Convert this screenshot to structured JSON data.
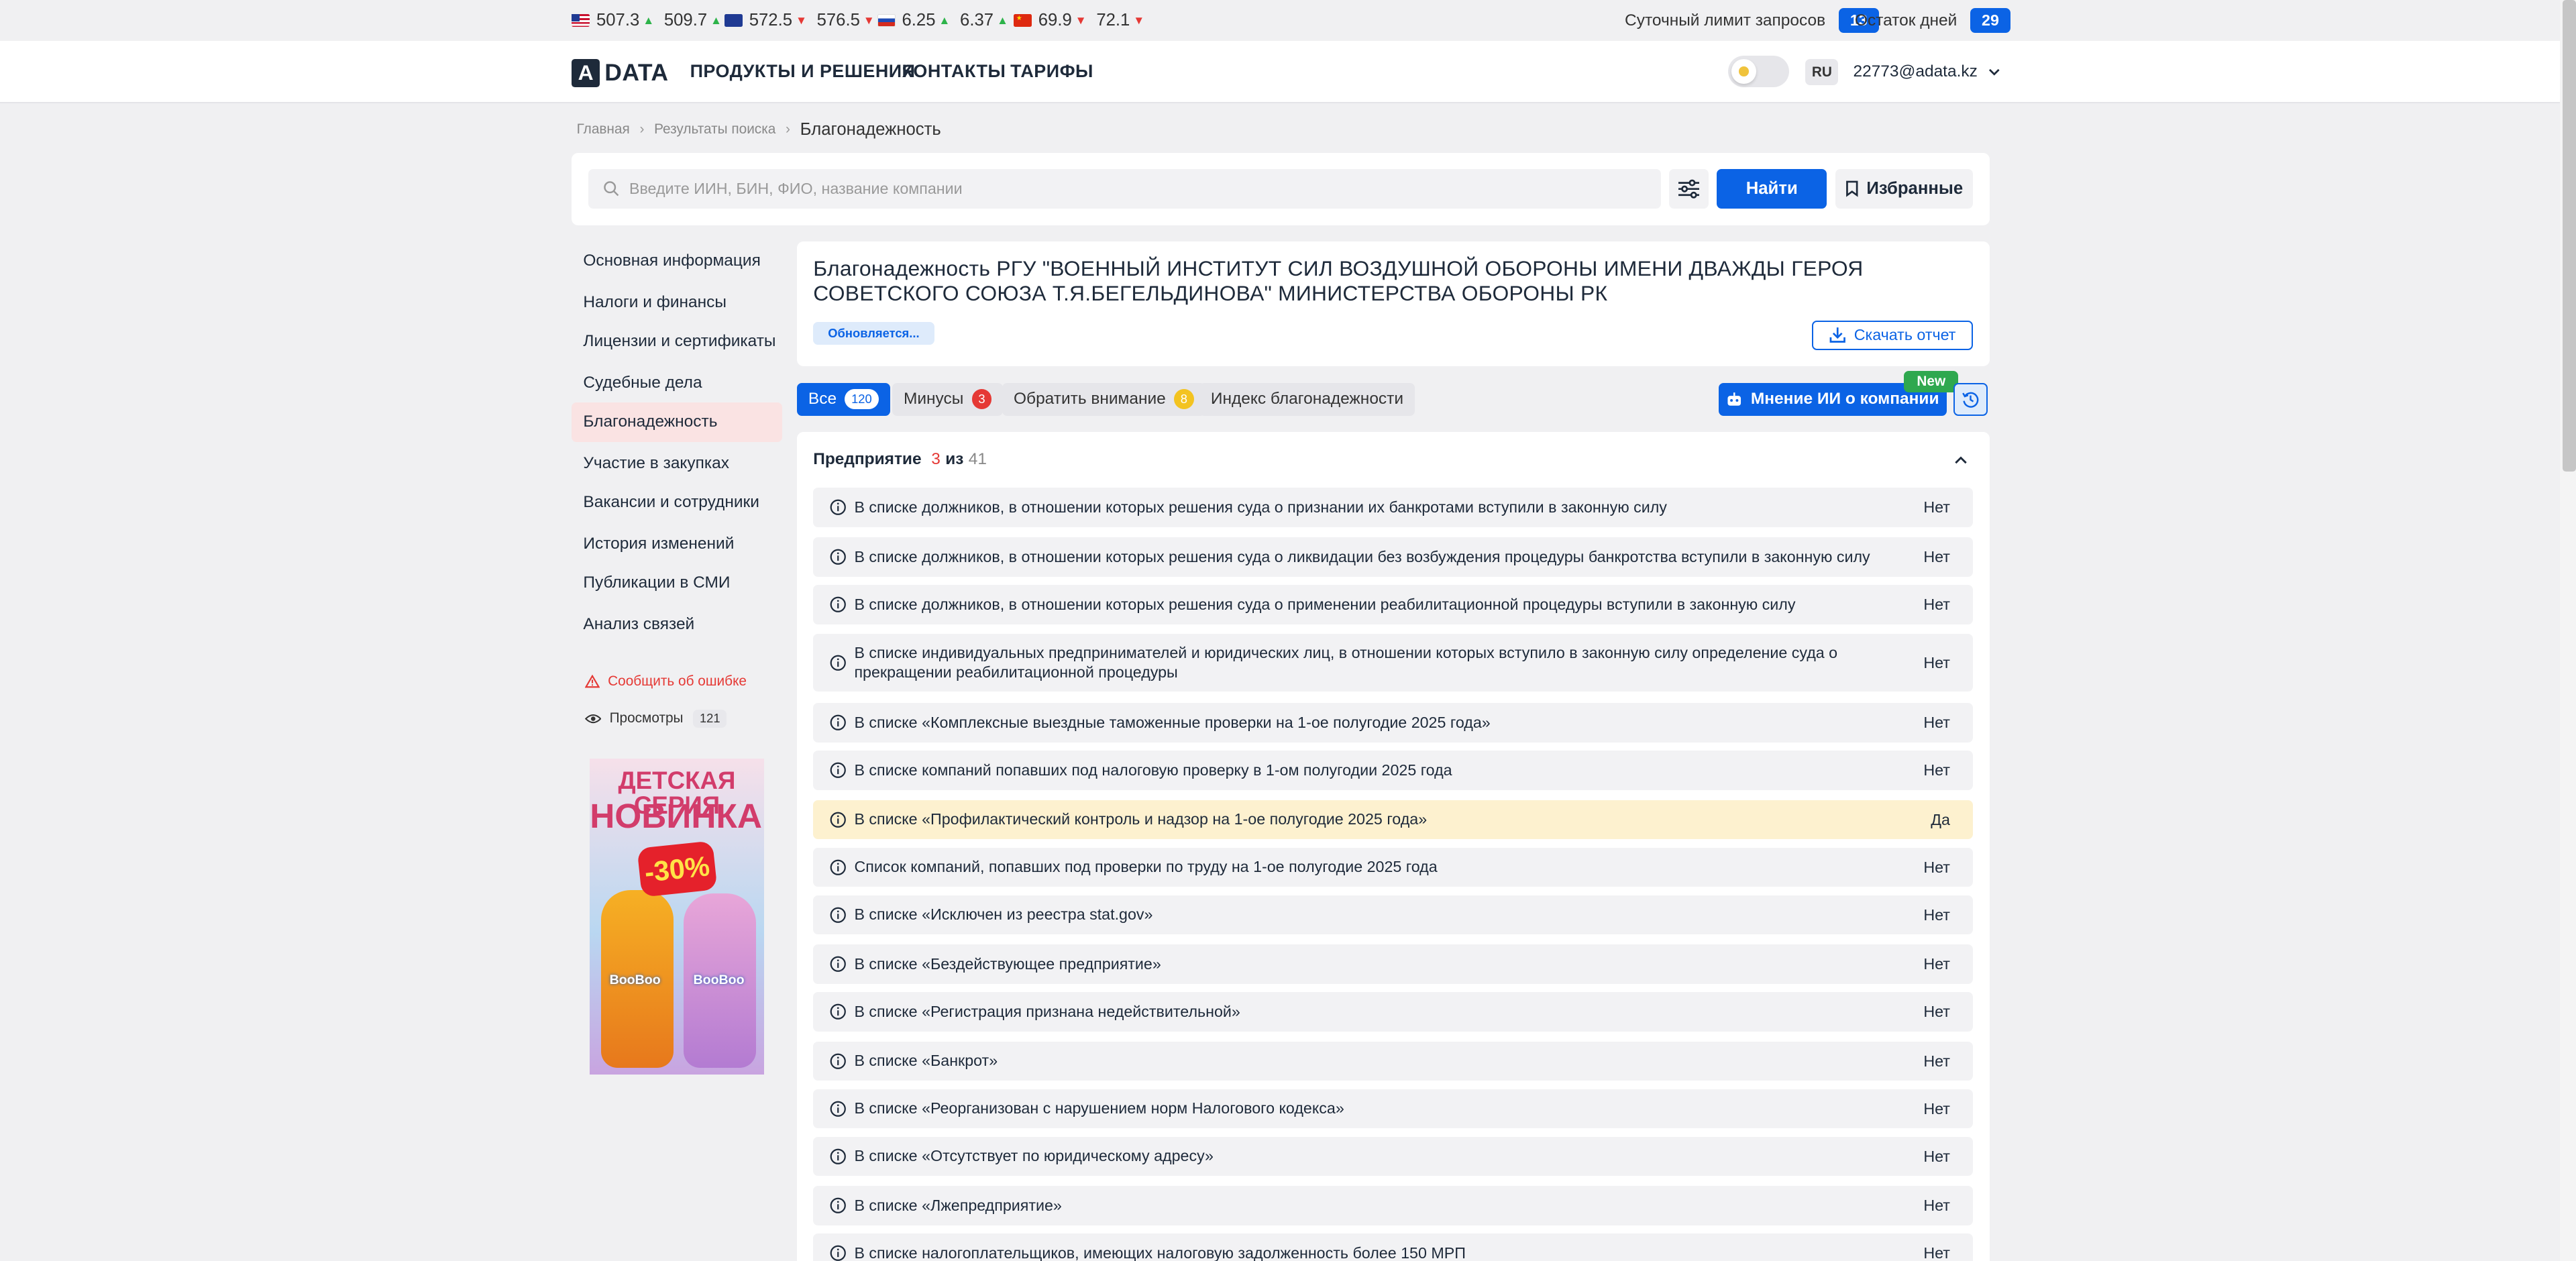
{
  "currencies": [
    {
      "flag": "us",
      "buy": "507.3",
      "buy_dir": "up",
      "sell": "509.7",
      "sell_dir": "up"
    },
    {
      "flag": "eu",
      "buy": "572.5",
      "buy_dir": "down",
      "sell": "576.5",
      "sell_dir": "down"
    },
    {
      "flag": "ru",
      "buy": "6.25",
      "buy_dir": "up",
      "sell": "6.37",
      "sell_dir": "up"
    },
    {
      "flag": "cn",
      "buy": "69.9",
      "buy_dir": "down",
      "sell": "72.1",
      "sell_dir": "down"
    }
  ],
  "limits": {
    "daily_label": "Суточный лимит запросов",
    "daily_value": "13",
    "days_label": "Остаток дней",
    "days_value": "29"
  },
  "header": {
    "logo_letter": "A",
    "logo_text": "DATA",
    "nav": [
      "ПРОДУКТЫ И РЕШЕНИЯ",
      "КОНТАКТЫ",
      "ТАРИФЫ"
    ],
    "lang": "RU",
    "user": "22773@adata.kz"
  },
  "breadcrumb": {
    "home": "Главная",
    "results": "Результаты поиска",
    "current": "Благонадежность"
  },
  "search": {
    "placeholder": "Введите ИИН, БИН, ФИО, название компании",
    "find_label": "Найти",
    "favorites_label": "Избранные"
  },
  "sidebar": {
    "items": [
      "Основная информация",
      "Налоги и финансы",
      "Лицензии и сертификаты",
      "Судебные дела",
      "Благонадежность",
      "Участие в закупках",
      "Вакансии и сотрудники",
      "История изменений",
      "Публикации в СМИ",
      "Анализ связей"
    ],
    "active_index": 4,
    "report_error": "Сообщить об ошибке",
    "views_label": "Просмотры",
    "views_count": "121"
  },
  "ad": {
    "line1": "ДЕТСКАЯ СЕРИЯ",
    "line2": "НОВИНКА!",
    "discount": "-30%",
    "brand": "BooBoo"
  },
  "company": {
    "title": "Благонадежность РГУ \"ВОЕННЫЙ ИНСТИТУТ СИЛ ВОЗДУШНОЙ ОБОРОНЫ ИМЕНИ ДВАЖДЫ ГЕРОЯ СОВЕТСКОГО СОЮЗА Т.Я.БЕГЕЛЬДИНОВА\" МИНИСТЕРСТВА ОБОРОНЫ РК",
    "status": "Обновляется...",
    "download_label": "Скачать отчет"
  },
  "tabs": [
    {
      "label": "Все",
      "count": "120",
      "color": "white"
    },
    {
      "label": "Минусы",
      "count": "3",
      "color": "red"
    },
    {
      "label": "Обратить внимание",
      "count": "8",
      "color": "yellow"
    },
    {
      "label": "Индекс благонадежности",
      "count": "",
      "color": ""
    }
  ],
  "ai": {
    "label": "Мнение ИИ о компании",
    "badge": "New"
  },
  "section": {
    "title": "Предприятие",
    "found": "3",
    "of": "из",
    "total": "41"
  },
  "checks": [
    {
      "text": "В списке должников, в отношении которых решения суда о признании их банкротами вступили в законную силу",
      "value": "Нет",
      "highlight": false
    },
    {
      "text": "В списке должников, в отношении которых решения суда о ликвидации без возбуждения процедуры банкротства вступили в законную силу",
      "value": "Нет",
      "highlight": false
    },
    {
      "text": "В списке должников, в отношении которых решения суда о применении реабилитационной процедуры вступили в законную силу",
      "value": "Нет",
      "highlight": false
    },
    {
      "text": "В списке индивидуальных предпринимателей и юридических лиц, в отношении которых вступило в законную силу определение суда о прекращении реабилитационной процедуры",
      "value": "Нет",
      "highlight": false
    },
    {
      "text": "В списке «Комплексные выездные таможенные проверки на 1-ое полугодие 2025 года»",
      "value": "Нет",
      "highlight": false
    },
    {
      "text": "В списке компаний попавших под налоговую проверку в 1-ом полугодии 2025 года",
      "value": "Нет",
      "highlight": false
    },
    {
      "text": "В списке «Профилактический контроль и надзор на 1-ое полугодие 2025 года»",
      "value": "Да",
      "highlight": true
    },
    {
      "text": "Список компаний, попавших под проверки по труду на 1-ое полугодие 2025 года",
      "value": "Нет",
      "highlight": false
    },
    {
      "text": "В списке «Исключен из реестра stat.gov»",
      "value": "Нет",
      "highlight": false
    },
    {
      "text": "В списке «Бездействующее предприятие»",
      "value": "Нет",
      "highlight": false
    },
    {
      "text": "В списке «Регистрация признана недействительной»",
      "value": "Нет",
      "highlight": false
    },
    {
      "text": "В списке «Банкрот»",
      "value": "Нет",
      "highlight": false
    },
    {
      "text": "В списке «Реорганизован с нарушением норм Налогового кодекса»",
      "value": "Нет",
      "highlight": false
    },
    {
      "text": "В списке «Отсутствует по юридическому адресу»",
      "value": "Нет",
      "highlight": false
    },
    {
      "text": "В списке «Лжепредприятие»",
      "value": "Нет",
      "highlight": false
    },
    {
      "text": "В списке налогоплательщиков, имеющих налоговую задолженность более 150 МРП",
      "value": "Нет",
      "highlight": false
    }
  ],
  "colors": {
    "accent": "#0b63e5",
    "up": "#2db34a",
    "down": "#e53935",
    "highlight_row": "#fdf1cf",
    "active_sidebar": "#fae3e3"
  }
}
